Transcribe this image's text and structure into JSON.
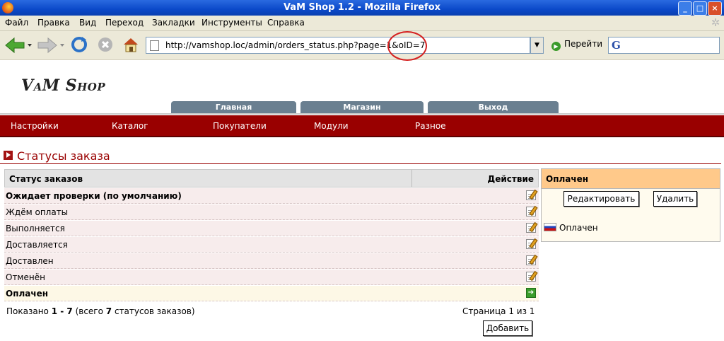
{
  "window": {
    "title": "VaM Shop 1.2 - Mozilla Firefox"
  },
  "menu": [
    "Файл",
    "Правка",
    "Вид",
    "Переход",
    "Закладки",
    "Инструменты",
    "Справка"
  ],
  "toolbar": {
    "url": "http://vamshop.loc/admin/orders_status.php?page=1&oID=7",
    "go_label": "Перейти",
    "search_logo": "G"
  },
  "site": {
    "logo": "VaM Shop",
    "tabs": [
      "Главная",
      "Магазин",
      "Выход"
    ],
    "nav": [
      "Настройки",
      "Каталог",
      "Покупатели",
      "Модули",
      "Разное"
    ]
  },
  "page": {
    "heading": "Статусы заказа",
    "table": {
      "col_status": "Статус заказов",
      "col_action": "Действие",
      "rows": [
        {
          "label": "Ожидает проверки (по умолчанию)",
          "bold": true,
          "icon": "edit-icon"
        },
        {
          "label": "Ждём оплаты",
          "bold": false,
          "icon": "edit-icon"
        },
        {
          "label": "Выполняется",
          "bold": false,
          "icon": "edit-icon"
        },
        {
          "label": "Доставляется",
          "bold": false,
          "icon": "edit-icon"
        },
        {
          "label": "Доставлен",
          "bold": false,
          "icon": "edit-icon"
        },
        {
          "label": "Отменён",
          "bold": false,
          "icon": "edit-icon"
        },
        {
          "label": "Оплачен",
          "bold": true,
          "icon": "arrow-right-icon",
          "selected": true
        }
      ]
    },
    "footer": {
      "shown_prefix": "Показано ",
      "shown_range": "1 - 7",
      "shown_mid": " (всего ",
      "shown_total": "7",
      "shown_suffix": " статусов заказов)",
      "pages": "Страница 1 из 1",
      "add_button": "Добавить"
    },
    "info_box": {
      "title": "Оплачен",
      "edit_button": "Редактировать",
      "delete_button": "Удалить",
      "language_name": "Оплачен"
    }
  }
}
